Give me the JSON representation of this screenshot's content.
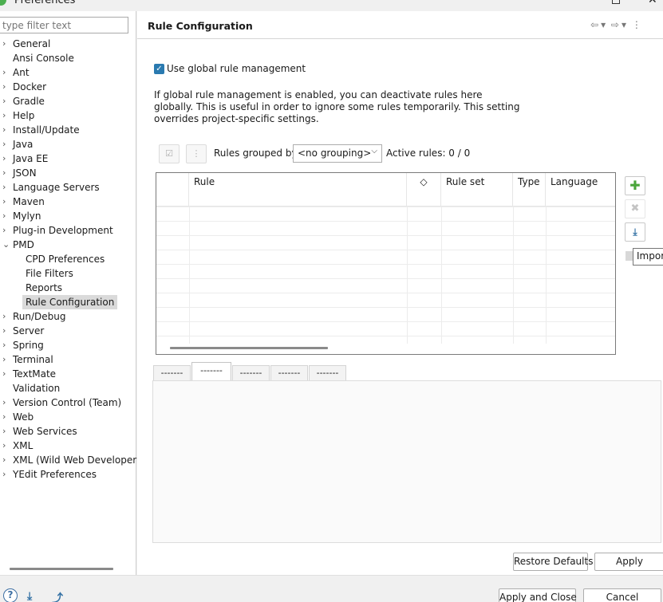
{
  "window": {
    "title": "Preferences"
  },
  "filter": {
    "placeholder": "type filter text"
  },
  "tree": [
    {
      "label": "General",
      "expandable": true
    },
    {
      "label": "Ansi Console",
      "expandable": false
    },
    {
      "label": "Ant",
      "expandable": true
    },
    {
      "label": "Docker",
      "expandable": true
    },
    {
      "label": "Gradle",
      "expandable": true
    },
    {
      "label": "Help",
      "expandable": true
    },
    {
      "label": "Install/Update",
      "expandable": true
    },
    {
      "label": "Java",
      "expandable": true
    },
    {
      "label": "Java EE",
      "expandable": true
    },
    {
      "label": "JSON",
      "expandable": true
    },
    {
      "label": "Language Servers",
      "expandable": true
    },
    {
      "label": "Maven",
      "expandable": true
    },
    {
      "label": "Mylyn",
      "expandable": true
    },
    {
      "label": "Plug-in Development",
      "expandable": true
    },
    {
      "label": "PMD",
      "expandable": true,
      "expanded": true
    },
    {
      "label": "CPD Preferences",
      "child": true
    },
    {
      "label": "File Filters",
      "child": true
    },
    {
      "label": "Reports",
      "child": true
    },
    {
      "label": "Rule Configuration",
      "child": true,
      "selected": true
    },
    {
      "label": "Run/Debug",
      "expandable": true
    },
    {
      "label": "Server",
      "expandable": true
    },
    {
      "label": "Spring",
      "expandable": true
    },
    {
      "label": "Terminal",
      "expandable": true
    },
    {
      "label": "TextMate",
      "expandable": true
    },
    {
      "label": "Validation",
      "expandable": false
    },
    {
      "label": "Version Control (Team)",
      "expandable": true
    },
    {
      "label": "Web",
      "expandable": true
    },
    {
      "label": "Web Services",
      "expandable": true
    },
    {
      "label": "XML",
      "expandable": true
    },
    {
      "label": "XML (Wild Web Developer)",
      "expandable": true
    },
    {
      "label": "YEdit Preferences",
      "expandable": true
    }
  ],
  "page": {
    "title": "Rule Configuration",
    "global_checkbox": {
      "label": "Use global rule management",
      "checked": true
    },
    "description": "If global rule management is enabled, you can deactivate rules here globally. This is useful in order to ignore some rules temporarily. This setting overrides project-specific settings.",
    "grouped_by_label": "Rules grouped by",
    "grouping_value": "<no grouping>",
    "active_rules": "Active rules: 0 / 0",
    "columns": [
      "Rule",
      "◇",
      "Rule set",
      "Type",
      "Language"
    ],
    "tooltip": "Import",
    "tabs": [
      "-------",
      "-------",
      "-------",
      "-------",
      "-------"
    ],
    "active_tab_index": 1,
    "restore_defaults": "Restore Defaults",
    "apply": "Apply"
  },
  "bottom": {
    "help_glyph": "?",
    "apply_and_close": "Apply and Close",
    "cancel": "Cancel"
  },
  "colors": {
    "accent": "#2a7ab0",
    "add": "#4aa53a",
    "selection": "#dadada"
  }
}
